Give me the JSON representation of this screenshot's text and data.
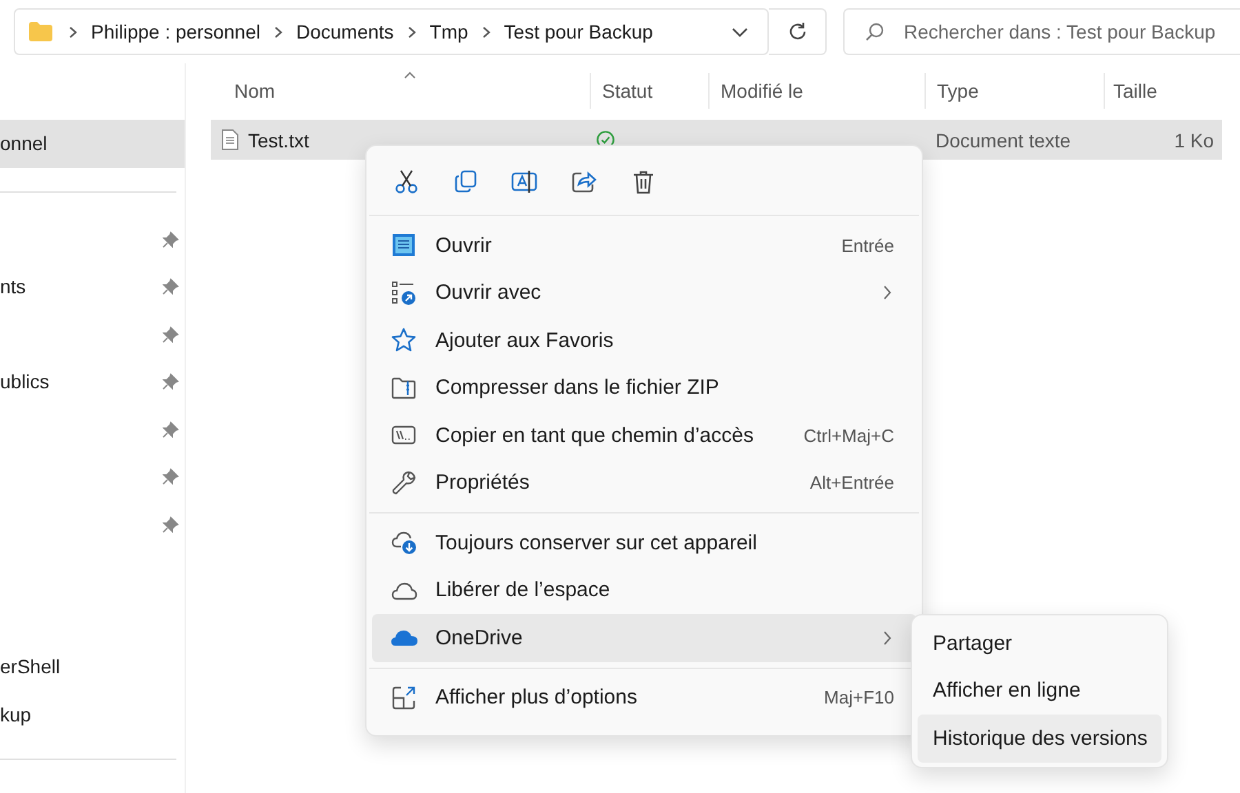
{
  "address_bar": {
    "breadcrumbs": [
      "Philippe : personnel",
      "Documents",
      "Tmp",
      "Test pour Backup"
    ]
  },
  "search": {
    "placeholder": "Rechercher dans : Test pour Backup"
  },
  "sidebar": {
    "items": [
      {
        "label": "onnel",
        "selected": true,
        "pinned": false
      },
      {
        "selected": false,
        "pinned": true
      },
      {
        "label": "nts",
        "selected": false,
        "pinned": true
      },
      {
        "selected": false,
        "pinned": true
      },
      {
        "label": "ublics",
        "selected": false,
        "pinned": true
      },
      {
        "selected": false,
        "pinned": true
      },
      {
        "selected": false,
        "pinned": true
      },
      {
        "selected": false,
        "pinned": true
      }
    ],
    "lower_items": [
      {
        "label": "erShell",
        "selected": false
      },
      {
        "label": "kup",
        "selected": false
      }
    ]
  },
  "table": {
    "columns": [
      "Nom",
      "Statut",
      "Modifié le",
      "Type",
      "Taille"
    ],
    "rows": [
      {
        "name": "Test.txt",
        "type": "Document texte",
        "size": "1 Ko",
        "selected": true
      }
    ]
  },
  "context_menu": {
    "sections": [
      [
        {
          "label": "Ouvrir",
          "shortcut": "Entrée",
          "submenu": false,
          "selected": false
        },
        {
          "label": "Ouvrir avec",
          "submenu": true,
          "selected": false
        },
        {
          "label": "Ajouter aux Favoris",
          "submenu": false,
          "selected": false
        },
        {
          "label": "Compresser dans le fichier ZIP",
          "submenu": false,
          "selected": false
        },
        {
          "label": "Copier en tant que chemin d’accès",
          "shortcut": "Ctrl+Maj+C",
          "submenu": false,
          "selected": false
        },
        {
          "label": "Propriétés",
          "shortcut": "Alt+Entrée",
          "submenu": false,
          "selected": false
        }
      ],
      [
        {
          "label": "Toujours conserver sur cet appareil",
          "submenu": false,
          "selected": false
        },
        {
          "label": "Libérer de l’espace",
          "submenu": false,
          "selected": false
        },
        {
          "label": "OneDrive",
          "submenu": true,
          "selected": true
        }
      ],
      [
        {
          "label": "Afficher plus d’options",
          "shortcut": "Maj+F10",
          "submenu": false,
          "selected": false
        }
      ]
    ]
  },
  "submenu": {
    "items": [
      {
        "label": "Partager",
        "selected": false
      },
      {
        "label": "Afficher en ligne",
        "selected": false
      },
      {
        "label": "Historique des versions",
        "selected": true
      }
    ]
  }
}
